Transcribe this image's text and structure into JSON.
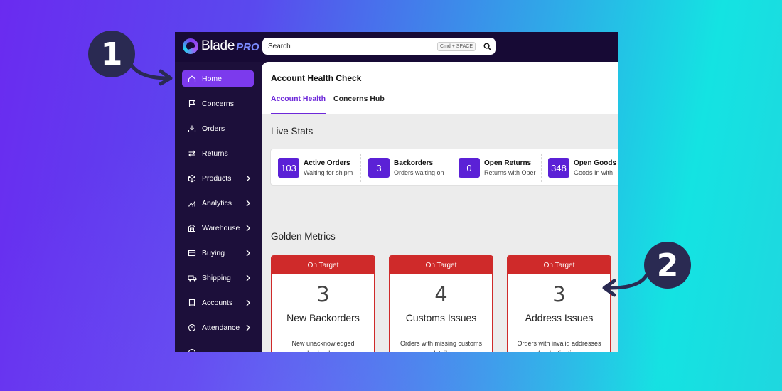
{
  "app": {
    "logo_text": "Blade",
    "logo_pro": "PRO"
  },
  "search": {
    "label": "Search",
    "shortcut": "Cmd + SPACE"
  },
  "sidebar": {
    "items": [
      {
        "label": "Home",
        "icon": "home-icon",
        "active": true
      },
      {
        "label": "Concerns",
        "icon": "flag-icon"
      },
      {
        "label": "Orders",
        "icon": "download-icon"
      },
      {
        "label": "Returns",
        "icon": "swap-icon"
      },
      {
        "label": "Products",
        "icon": "box-icon",
        "expandable": true
      },
      {
        "label": "Analytics",
        "icon": "chart-icon",
        "expandable": true
      },
      {
        "label": "Warehouse",
        "icon": "warehouse-icon",
        "expandable": true
      },
      {
        "label": "Buying",
        "icon": "card-icon",
        "expandable": true
      },
      {
        "label": "Shipping",
        "icon": "truck-icon",
        "expandable": true
      },
      {
        "label": "Accounts",
        "icon": "book-icon",
        "expandable": true
      },
      {
        "label": "Attendance",
        "icon": "clock-icon",
        "expandable": true
      }
    ]
  },
  "main": {
    "title": "Account Health Check",
    "tabs": [
      {
        "label": "Account Health",
        "active": true
      },
      {
        "label": "Concerns Hub"
      }
    ],
    "live_stats_title": "Live Stats",
    "stats": [
      {
        "value": "103",
        "title": "Active Orders",
        "sub": "Waiting for shipm"
      },
      {
        "value": "3",
        "title": "Backorders",
        "sub": "Orders waiting on"
      },
      {
        "value": "0",
        "title": "Open Returns",
        "sub": "Returns with Oper"
      },
      {
        "value": "348",
        "title": "Open Goods",
        "sub": "Goods In with"
      }
    ],
    "golden_title": "Golden Metrics",
    "cards": [
      {
        "status": "On Target",
        "value": "3",
        "name": "New Backorders",
        "desc": "New unacknowledged backorders"
      },
      {
        "status": "On Target",
        "value": "4",
        "name": "Customs Issues",
        "desc": "Orders with missing customs details"
      },
      {
        "status": "On Target",
        "value": "3",
        "name": "Address Issues",
        "desc": "Orders with invalid addresses for destination."
      }
    ]
  },
  "annotations": [
    {
      "label": "1"
    },
    {
      "label": "2"
    }
  ],
  "colors": {
    "accent": "#7c3aed",
    "status_red": "#cf2a2a",
    "sidebar_bg": "#1c0f3a",
    "badge_bg": "#2a2a52"
  }
}
